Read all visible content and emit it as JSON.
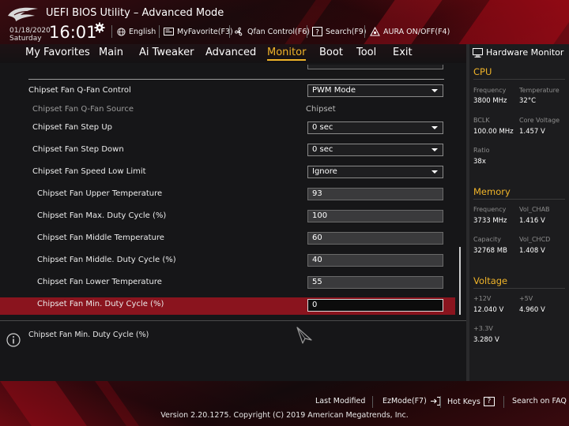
{
  "header": {
    "title": "UEFI BIOS Utility – Advanced Mode",
    "date": "01/18/2020",
    "day": "Saturday",
    "time": "16:01",
    "items": [
      {
        "label": "English",
        "icon": "globe-icon"
      },
      {
        "label": "MyFavorite(F3)",
        "icon": "favorite-icon"
      },
      {
        "label": "Qfan Control(F6)",
        "icon": "fan-icon"
      },
      {
        "label": "Search(F9)",
        "icon": "search-help-icon"
      },
      {
        "label": "AURA ON/OFF(F4)",
        "icon": "aura-icon"
      }
    ]
  },
  "nav": {
    "tabs": [
      {
        "label": "My Favorites"
      },
      {
        "label": "Main"
      },
      {
        "label": "Ai Tweaker"
      },
      {
        "label": "Advanced"
      },
      {
        "label": "Monitor",
        "active": true
      },
      {
        "label": "Boot"
      },
      {
        "label": "Tool"
      },
      {
        "label": "Exit"
      }
    ]
  },
  "settings": [
    {
      "label": "Chipset Fan Q-Fan Control",
      "value": "PWM Mode",
      "type": "select"
    },
    {
      "label": "Chipset Fan Q-Fan Source",
      "value": "Chipset",
      "type": "static"
    },
    {
      "label": "Chipset Fan Step Up",
      "value": "0 sec",
      "type": "select"
    },
    {
      "label": "Chipset Fan Step Down",
      "value": "0 sec",
      "type": "select"
    },
    {
      "label": "Chipset Fan Speed Low Limit",
      "value": "Ignore",
      "type": "select"
    },
    {
      "label": "Chipset Fan Upper Temperature",
      "value": "93",
      "type": "input"
    },
    {
      "label": "Chipset Fan Max. Duty Cycle (%)",
      "value": "100",
      "type": "input"
    },
    {
      "label": "Chipset Fan Middle Temperature",
      "value": "60",
      "type": "input"
    },
    {
      "label": "Chipset Fan Middle. Duty Cycle (%)",
      "value": "40",
      "type": "input"
    },
    {
      "label": "Chipset Fan Lower Temperature",
      "value": "55",
      "type": "input"
    },
    {
      "label": "Chipset Fan Min. Duty Cycle (%)",
      "value": "0",
      "type": "input",
      "selected": true
    }
  ],
  "help": {
    "text": "Chipset Fan Min. Duty Cycle (%)"
  },
  "hw_monitor": {
    "title": "Hardware Monitor",
    "cpu": {
      "heading": "CPU",
      "frequency_label": "Frequency",
      "frequency": "3800 MHz",
      "temperature_label": "Temperature",
      "temperature": "32°C",
      "bclk_label": "BCLK",
      "bclk": "100.00 MHz",
      "core_voltage_label": "Core Voltage",
      "core_voltage": "1.457 V",
      "ratio_label": "Ratio",
      "ratio": "38x"
    },
    "memory": {
      "heading": "Memory",
      "frequency_label": "Frequency",
      "frequency": "3733 MHz",
      "vol_chab_label": "Vol_CHAB",
      "vol_chab": "1.416 V",
      "capacity_label": "Capacity",
      "capacity": "32768 MB",
      "vol_chcd_label": "Vol_CHCD",
      "vol_chcd": "1.408 V"
    },
    "voltage": {
      "heading": "Voltage",
      "v12_label": "+12V",
      "v12": "12.040 V",
      "v5_label": "+5V",
      "v5": "4.960 V",
      "v33_label": "+3.3V",
      "v33": "3.280 V"
    }
  },
  "footer": {
    "last_modified": "Last Modified",
    "ezmode": "EzMode(F7)",
    "hot_keys": "Hot Keys",
    "hot_keys_key": "?",
    "search_faq": "Search on FAQ",
    "version": "Version 2.20.1275. Copyright (C) 2019 American Megatrends, Inc."
  },
  "colors": {
    "accent": "#f0b429",
    "selected_row": "#8a141e",
    "brand_red": "#c8141e"
  }
}
